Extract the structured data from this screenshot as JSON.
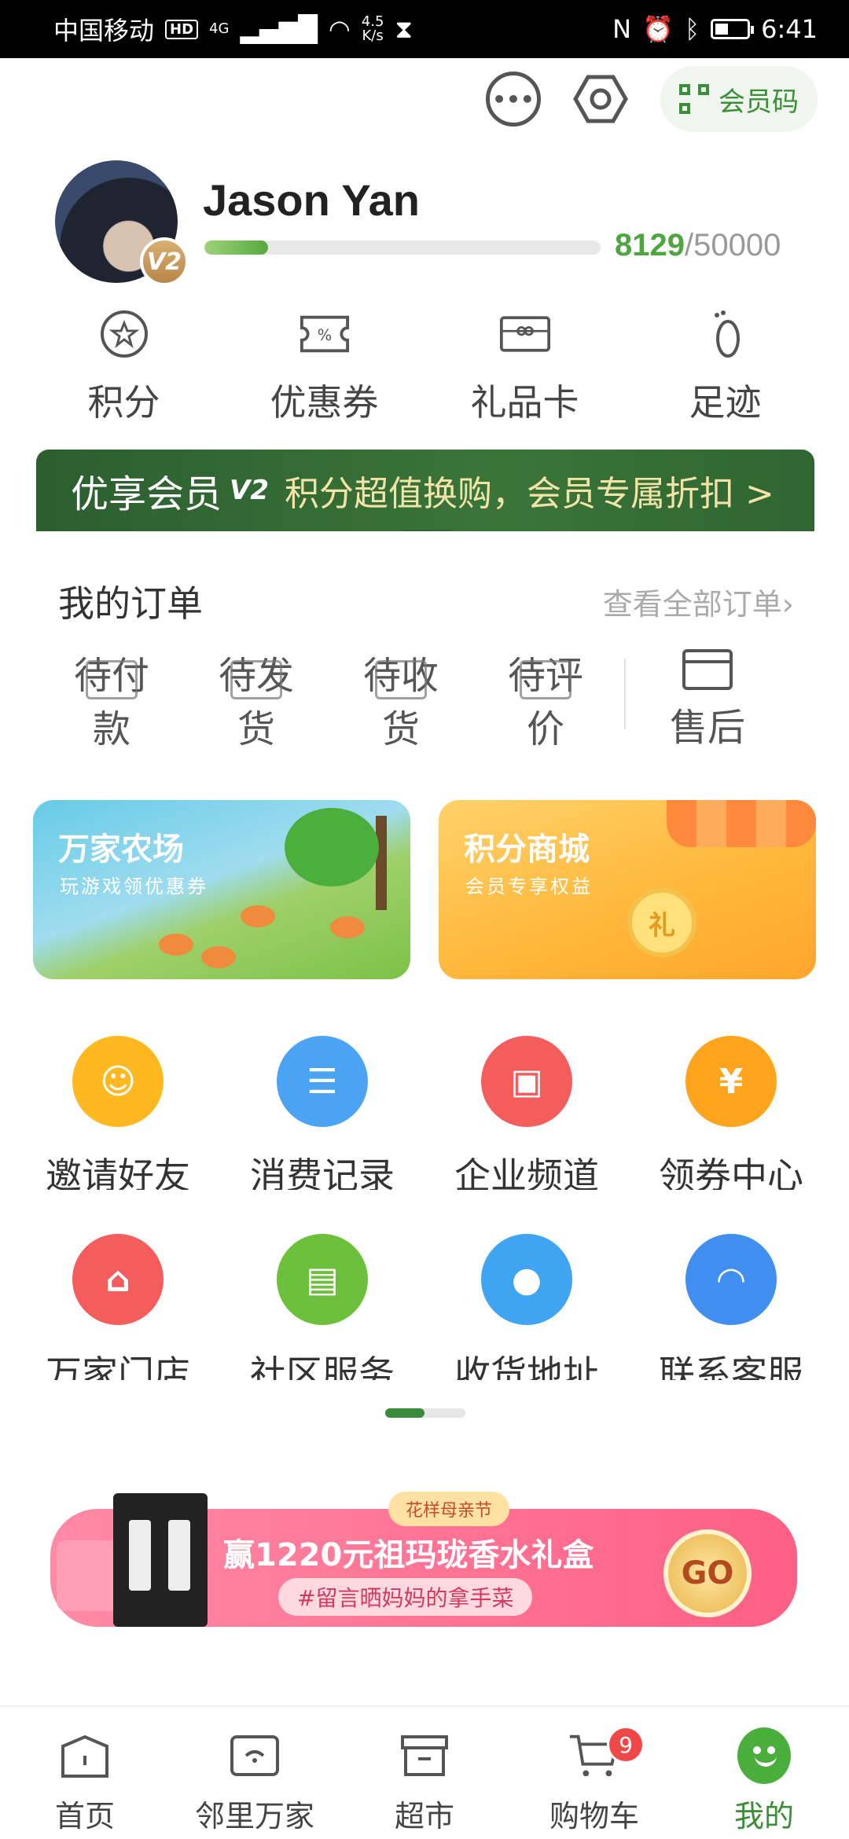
{
  "status_bar": {
    "carrier": "中国移动",
    "hd": "HD",
    "network": "4G",
    "speed_value": "4.5",
    "speed_unit": "K/s",
    "time": "6:41"
  },
  "header": {
    "member_code_label": "会员码"
  },
  "profile": {
    "name": "Jason Yan",
    "level_badge": "V2",
    "points_current": "8129",
    "points_separator": "/",
    "points_target": "50000",
    "progress_fraction": 0.16
  },
  "quick_links": [
    {
      "label": "积分",
      "icon": "star-badge-icon"
    },
    {
      "label": "优惠券",
      "icon": "coupon-icon"
    },
    {
      "label": "礼品卡",
      "icon": "gift-card-icon"
    },
    {
      "label": "足迹",
      "icon": "footprint-icon"
    }
  ],
  "vip_banner": {
    "title": "优享会员",
    "level": "V2",
    "description": "积分超值换购，会员专属折扣 >"
  },
  "orders": {
    "title": "我的订单",
    "view_all": "查看全部订单",
    "items": [
      {
        "label": "待付款"
      },
      {
        "label": "待发货"
      },
      {
        "label": "待收货"
      },
      {
        "label": "待评价"
      }
    ],
    "after_sale": "售后"
  },
  "promos": [
    {
      "title": "万家农场",
      "subtitle": "玩游戏领优惠券"
    },
    {
      "title": "积分商城",
      "subtitle": "会员专享权益",
      "coin": "礼"
    }
  ],
  "services": [
    {
      "label": "邀请好友",
      "icon": "invite-friend-icon",
      "color": "#ffb81f"
    },
    {
      "label": "消费记录",
      "icon": "receipt-icon",
      "color": "#4ba4f3"
    },
    {
      "label": "企业频道",
      "icon": "enterprise-icon",
      "color": "#f55d5d"
    },
    {
      "label": "领券中心",
      "icon": "coupon-center-icon",
      "color": "#ffa41c"
    },
    {
      "label": "万家门店",
      "icon": "store-icon",
      "color": "#f55d5d"
    },
    {
      "label": "社区服务",
      "icon": "community-icon",
      "color": "#6cc03b"
    },
    {
      "label": "收货地址",
      "icon": "location-pin-icon",
      "color": "#3fa4f2"
    },
    {
      "label": "联系客服",
      "icon": "headset-icon",
      "color": "#3f8ef0"
    }
  ],
  "ad": {
    "tag": "花样母亲节",
    "title": "赢1220元祖玛珑香水礼盒",
    "subtitle": "#留言晒妈妈的拿手菜",
    "go": "GO"
  },
  "bottom_nav": [
    {
      "label": "首页",
      "icon": "home-icon"
    },
    {
      "label": "邻里万家",
      "icon": "neighborhood-icon"
    },
    {
      "label": "超市",
      "icon": "supermarket-icon"
    },
    {
      "label": "购物车",
      "icon": "cart-icon",
      "badge": "9"
    },
    {
      "label": "我的",
      "icon": "me-icon",
      "active": true
    }
  ],
  "colors": {
    "brand_green": "#3b8f37",
    "vip_green": "#2f6532",
    "badge_red": "#f04848"
  }
}
